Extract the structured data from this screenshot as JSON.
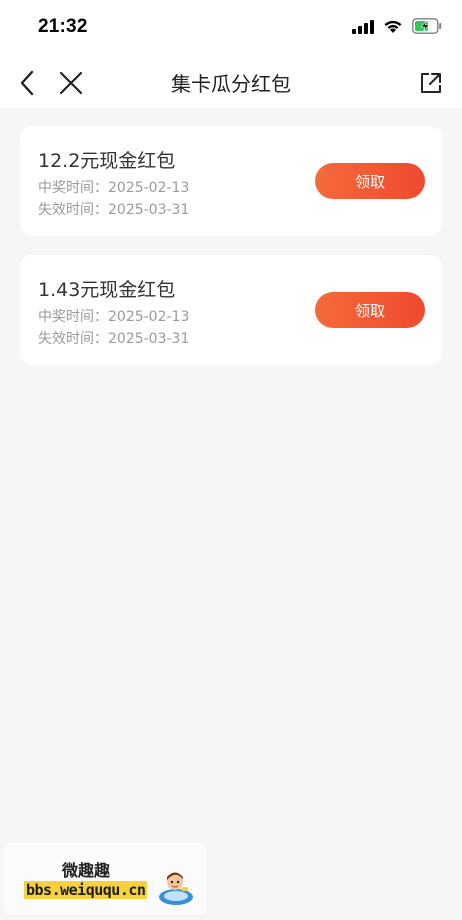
{
  "status_bar": {
    "time": "21:32"
  },
  "nav": {
    "title": "集卡瓜分红包"
  },
  "rewards": [
    {
      "title": "12.2元现金红包",
      "won_label": "中奖时间：",
      "won_date": "2025-02-13",
      "expire_label": "失效时间：",
      "expire_date": "2025-03-31",
      "button": "领取"
    },
    {
      "title": "1.43元现金红包",
      "won_label": "中奖时间：",
      "won_date": "2025-02-13",
      "expire_label": "失效时间：",
      "expire_date": "2025-03-31",
      "button": "领取"
    }
  ],
  "watermark": {
    "name": "微趣趣",
    "url": "bbs.weiququ.cn"
  },
  "colors": {
    "accent": "#ef4a2f",
    "battery": "#34c759"
  },
  "icons": {
    "back": "chevron-left-icon",
    "close": "close-icon",
    "share": "share-icon",
    "signal": "cellular-signal-icon",
    "wifi": "wifi-icon",
    "battery": "battery-charging-icon"
  }
}
